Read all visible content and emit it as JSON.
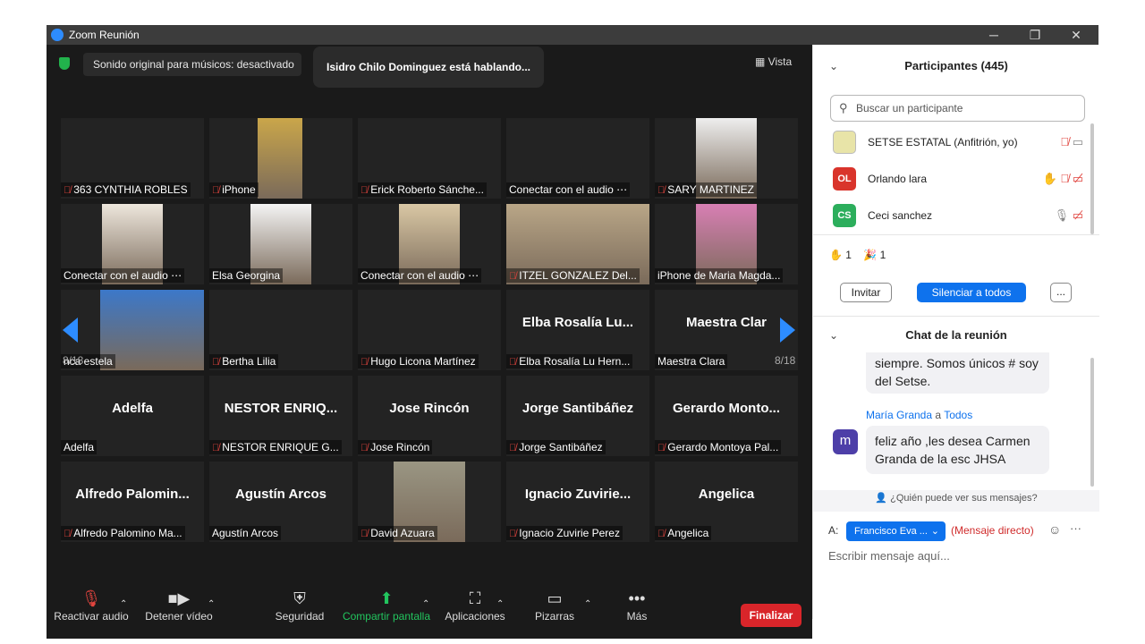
{
  "window": {
    "title": "Zoom Reunión"
  },
  "video": {
    "original_sound": "Sonido original para músicos: desactivado",
    "speaking": "Isidro Chilo Dominguez está hablando...",
    "view_label": "Vista",
    "page_left": "8/18",
    "page_right": "8/18"
  },
  "tiles": [
    {
      "name": "363 CYNTHIA ROBLES",
      "big": "",
      "muted": true
    },
    {
      "name": "iPhone",
      "big": "",
      "muted": true
    },
    {
      "name": "Erick Roberto Sánche...",
      "big": "",
      "muted": true
    },
    {
      "name": "Conectar con el audio ⋯",
      "big": "",
      "muted": false
    },
    {
      "name": "SARY MARTINEZ",
      "big": "",
      "muted": true
    },
    {
      "name": "Conectar con el audio ⋯",
      "big": "",
      "muted": false
    },
    {
      "name": "Elsa Georgina",
      "big": "",
      "muted": false
    },
    {
      "name": "Conectar con el audio ⋯",
      "big": "",
      "muted": false
    },
    {
      "name": "ITZEL GONZALEZ Del...",
      "big": "",
      "muted": true
    },
    {
      "name": "iPhone de Maria Magda...",
      "big": "",
      "muted": false
    },
    {
      "name": "nca estela",
      "big": "",
      "muted": false
    },
    {
      "name": "Bertha Lilia",
      "big": "",
      "muted": true
    },
    {
      "name": "Hugo Licona Martínez",
      "big": "",
      "muted": true
    },
    {
      "name": "Elba Rosalía Lu Hern...",
      "big": "Elba Rosalía Lu...",
      "muted": true
    },
    {
      "name": "Maestra Clara",
      "big": "Maestra Clar",
      "muted": false
    },
    {
      "name": "Adelfa",
      "big": "Adelfa",
      "muted": false
    },
    {
      "name": "NESTOR ENRIQUE G...",
      "big": "NESTOR ENRIQ...",
      "muted": true
    },
    {
      "name": "Jose Rincón",
      "big": "Jose Rincón",
      "muted": true
    },
    {
      "name": "Jorge Santibáñez",
      "big": "Jorge Santibáñez",
      "muted": true
    },
    {
      "name": "Gerardo Montoya Pal...",
      "big": "Gerardo Monto...",
      "muted": true
    },
    {
      "name": "Alfredo Palomino Ma...",
      "big": "Alfredo Palomin...",
      "muted": true
    },
    {
      "name": "Agustín Arcos",
      "big": "Agustín Arcos",
      "muted": false
    },
    {
      "name": "David Azuara",
      "big": "",
      "muted": true
    },
    {
      "name": "Ignacio Zuvirie Perez",
      "big": "Ignacio Zuvirie...",
      "muted": true
    },
    {
      "name": "Angelica",
      "big": "Angelica",
      "muted": true
    }
  ],
  "toolbar": {
    "unmute": "Reactivar audio",
    "video": "Detener vídeo",
    "security": "Seguridad",
    "share": "Compartir pantalla",
    "apps": "Aplicaciones",
    "whiteboards": "Pizarras",
    "more": "Más",
    "end": "Finalizar"
  },
  "participants": {
    "header": "Participantes (445)",
    "search_placeholder": "Buscar un participante",
    "list": [
      {
        "initials": "",
        "name": "SETSE ESTATAL (Anfitrión, yo)",
        "color": "#e8e4a8"
      },
      {
        "initials": "OL",
        "name": "Orlando lara",
        "color": "#d9342b"
      },
      {
        "initials": "CS",
        "name": "Ceci sanchez",
        "color": "#2cae5c"
      }
    ],
    "raised_hands": "1",
    "celebrate": "1",
    "invite": "Invitar",
    "mute_all": "Silenciar a todos",
    "more": "..."
  },
  "chat": {
    "header": "Chat de la reunión",
    "prev_message": "siempre. Somos únicos # soy del Setse.",
    "sender": "María Granda",
    "to_word": "a",
    "recipient_all": "Todos",
    "avatar": "m",
    "message": "feliz año ,les desea Carmen Granda de la esc JHSA",
    "privacy": "¿Quién puede ver sus mensajes?",
    "to_label": "A:",
    "to_value": "Francisco Eva ...",
    "dm_label": "(Mensaje directo)",
    "compose_placeholder": "Escribir mensaje aquí..."
  }
}
